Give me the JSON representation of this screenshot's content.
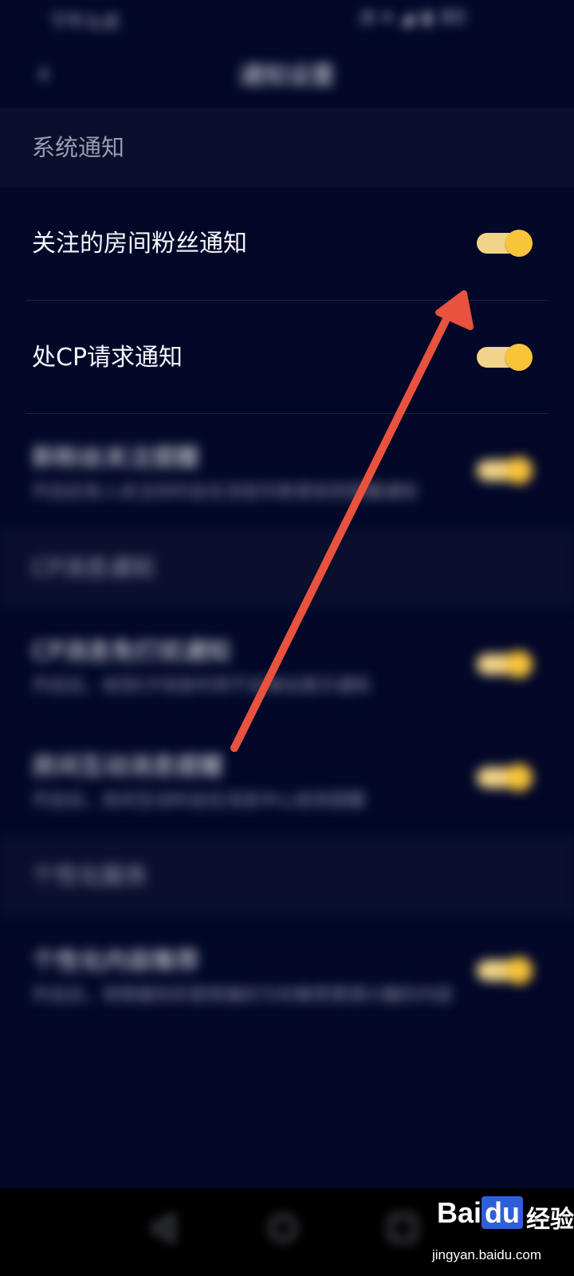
{
  "status_bar": {
    "time": "下午七点",
    "icons": "◔ ▾ ◢ ▮ 80"
  },
  "header": {
    "back_icon": "back-arrow-icon",
    "title": "通知设置"
  },
  "sections": [
    {
      "label": "系统通知"
    },
    {
      "label": "CP消息通知"
    },
    {
      "label": "个性化服务"
    }
  ],
  "rows": [
    {
      "title": "关注的房间粉丝通知",
      "subtitle": "",
      "enabled": true
    },
    {
      "title": "处CP请求通知",
      "subtitle": "",
      "enabled": true
    },
    {
      "title": "新粉丝关注提醒",
      "subtitle": "开启后有人关注你时会在消息列表里收到提醒通知",
      "enabled": true
    },
    {
      "title": "CP消息免打扰通知",
      "subtitle": "开启后，收到CP消息时将不会弹出提示通知",
      "enabled": true
    },
    {
      "title": "房间互动消息提醒",
      "subtitle": "开启后，房间互动时会在消息中心收到提醒",
      "enabled": true
    },
    {
      "title": "个性化内容推荐",
      "subtitle": "开启后，将根据你的使用偏好为你推荐更感兴趣的内容",
      "enabled": true
    }
  ],
  "nav_bar": {
    "back": "nav-back-icon",
    "home": "nav-home-icon",
    "recent": "nav-recent-icon"
  },
  "watermark": {
    "brand_bai": "Bai",
    "brand_du": "du",
    "brand_cn": "经验",
    "url": "jingyan.baidu.com"
  },
  "colors": {
    "background": "#030829",
    "section": "#0a0f2e",
    "toggle_knob": "#f8c43a",
    "toggle_track": "#f1d489",
    "arrow": "#e8523e"
  }
}
